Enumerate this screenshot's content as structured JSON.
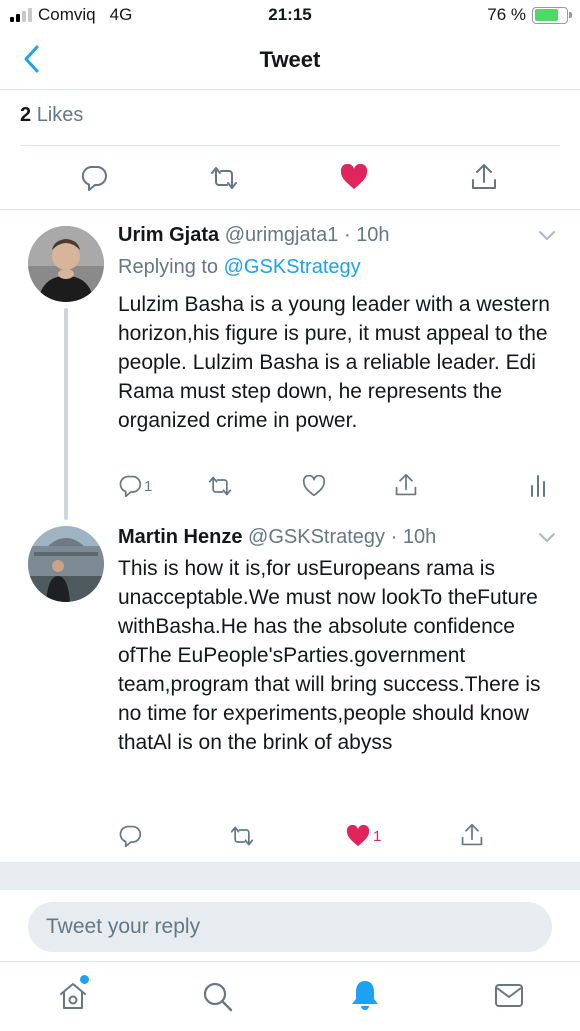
{
  "status_bar": {
    "carrier": "Comviq",
    "network": "4G",
    "time": "21:15",
    "battery": "76 %",
    "battery_level": 0.76
  },
  "header": {
    "title": "Tweet"
  },
  "likes": {
    "count": "2",
    "label": "Likes"
  },
  "replies": [
    {
      "name": "Urim Gjata",
      "handle": "@urimgjata1",
      "time": "10h",
      "replying_prefix": "Replying to",
      "replying_to": "@GSKStrategy",
      "text": "Lulzim Basha is a young leader with a western horizon,his figure is pure, it must appeal to the people. Lulzim Basha is a reliable leader. Edi Rama must step down, he represents the organized crime in power.",
      "reply_count": "1"
    },
    {
      "name": "Martin Henze",
      "handle": "@GSKStrategy",
      "time": "10h",
      "text": "This is how it is,for usEuropeans rama is unacceptable.We must now lookTo theFuture withBasha.He has the absolute confidence ofThe EuPeople'sParties.government team,program that will bring success.There is no time for experiments,people should know thatAl is on the brink of abyss",
      "like_count": "1"
    }
  ],
  "composer": {
    "placeholder": "Tweet your reply"
  },
  "colors": {
    "accent": "#1da1f2",
    "like": "#e0245e",
    "secondary_text": "#657786",
    "icon": "#657786"
  },
  "tabbar": {
    "icons": [
      "home-icon",
      "search-icon",
      "notifications-icon",
      "messages-icon"
    ]
  }
}
